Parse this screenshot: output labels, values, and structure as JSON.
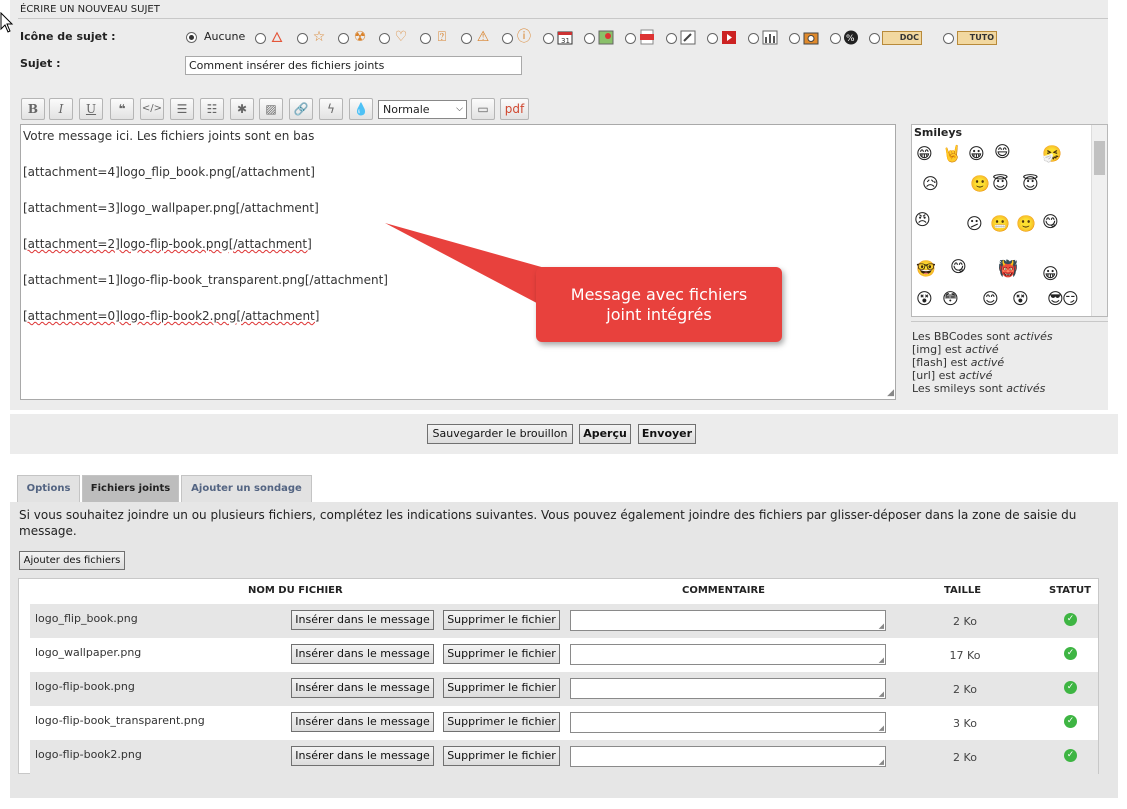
{
  "section_title": "ÉCRIRE UN NOUVEAU SUJET",
  "topic_icon": {
    "label": "Icône de sujet :",
    "none_label": "Aucune",
    "icons": [
      "flame-icon",
      "star-icon",
      "radiation-icon",
      "heart-icon",
      "question-icon",
      "warning-icon",
      "info-icon",
      "calendar-icon",
      "map-icon",
      "pdf-icon",
      "link-icon",
      "video-icon",
      "chart-icon",
      "camera-icon",
      "percent-icon",
      "doc-icon",
      "tuto-icon"
    ],
    "doc_label": "DOC",
    "tuto_label": "TUTO"
  },
  "subject": {
    "label": "Sujet :",
    "value": "Comment insérer des fichiers joints"
  },
  "toolbar": {
    "font_size_value": "Normale",
    "pdf_label": "pdf",
    "buttons": [
      "bold",
      "italic",
      "underline",
      "quote",
      "code",
      "list",
      "list-numbered",
      "asterisk",
      "image",
      "url",
      "flash",
      "color"
    ]
  },
  "editor": {
    "line1": "Votre message ici. Les fichiers joints sont en bas",
    "line2": "[attachment=4]logo_flip_book.png[/attachment]",
    "line3": "[attachment=3]logo_wallpaper.png[/attachment]",
    "line4": "[attachment=2]logo-flip-book.png[/attachment]",
    "line5": "[attachment=1]logo-flip-book_transparent.png[/attachment]",
    "line6": "[attachment=0]logo-flip-book2.png[/attachment]"
  },
  "callout": "Message avec fichiers joint intégrés",
  "smileys": {
    "title": "Smileys",
    "items": [
      "😁",
      "🤘",
      "😀",
      "😄",
      "🤧",
      "😥",
      "🙂",
      "😇",
      "😇",
      "😠",
      "😕",
      "😬",
      "🙂",
      "😋",
      "🤓",
      "😋",
      "👹",
      "😀",
      "😵",
      "😳",
      "😊",
      "😵",
      "😎",
      "😏"
    ]
  },
  "bbinfo": {
    "bbcode_prefix": "Les BBCodes sont ",
    "bbcode_state": "activés",
    "img_prefix": "[img] est ",
    "img_state": "activé",
    "flash_prefix": "[flash] est ",
    "flash_state": "activé",
    "url_prefix": "[url] est ",
    "url_state": "activé",
    "smileys_prefix": "Les smileys sont ",
    "smileys_state": "activés"
  },
  "actions": {
    "save_draft": "Sauvegarder le brouillon",
    "preview": "Aperçu",
    "send": "Envoyer"
  },
  "tabs": [
    "Options",
    "Fichiers joints",
    "Ajouter un sondage"
  ],
  "attachments": {
    "description": "Si vous souhaitez joindre un ou plusieurs fichiers, complétez les indications suivantes. Vous pouvez également joindre des fichiers par glisser-déposer dans la zone de saisie du message.",
    "add_button": "Ajouter des fichiers",
    "headers": {
      "name": "NOM DU FICHIER",
      "comment": "COMMENTAIRE",
      "size": "TAILLE",
      "status": "STATUT"
    },
    "insert_label": "Insérer dans le message",
    "delete_label": "Supprimer le fichier",
    "files": [
      {
        "name": "logo_flip_book.png",
        "size": "2 Ko"
      },
      {
        "name": "logo_wallpaper.png",
        "size": "17 Ko"
      },
      {
        "name": "logo-flip-book.png",
        "size": "2 Ko"
      },
      {
        "name": "logo-flip-book_transparent.png",
        "size": "3 Ko"
      },
      {
        "name": "logo-flip-book2.png",
        "size": "2 Ko"
      }
    ]
  }
}
